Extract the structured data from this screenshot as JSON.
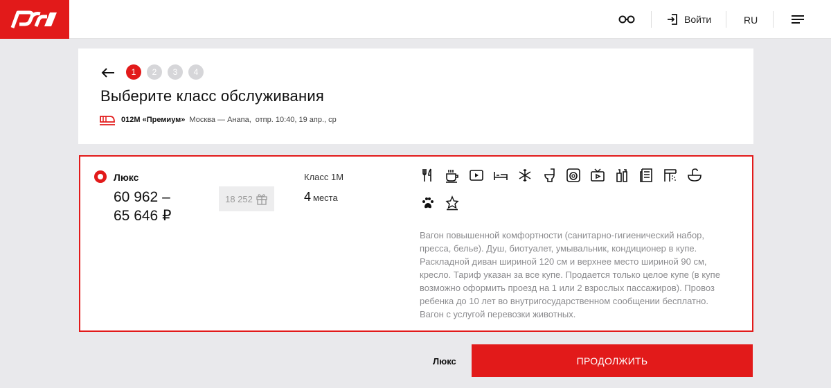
{
  "header": {
    "login_label": "Войти",
    "lang_label": "RU",
    "icons": [
      "rzd-logo",
      "glasses-icon",
      "login-icon",
      "menu-icon"
    ],
    "brand_color": "#e21a1a"
  },
  "wizard": {
    "steps": [
      "1",
      "2",
      "3",
      "4"
    ],
    "active_step": 1
  },
  "page": {
    "title": "Выберите класс обслуживания",
    "train_number": "012М «Премиум»",
    "route": "Москва — Анапа,",
    "departure": "отпр. 10:40, 19 апр., ср"
  },
  "option": {
    "name": "Люкс",
    "price_line1": "60 962 –",
    "price_line2": "65 646 ₽",
    "bonus_points": "18 252",
    "car_class": "Класс 1М",
    "seats_count": "4",
    "seats_label": "места",
    "amenities": [
      "restaurant-icon",
      "coffee-icon",
      "video-icon",
      "bed-icon",
      "air-conditioner-icon",
      "toilet-icon",
      "washing-machine-icon",
      "tv-icon",
      "hygiene-kit-icon",
      "press-icon",
      "shower-icon",
      "washbasin-icon",
      "pets-icon",
      "premium-service-icon"
    ],
    "description": "Вагон повышенной комфортности (санитарно-гигиенический набор, пресса, белье). Душ, биотуалет, умывальник, кондиционер в купе. Раскладной диван шириной 120 см и верхнее место шириной 90 см, кресло. Тариф указан за все купе. Продается только целое купе (в купе возможно оформить проезд на 1 или 2 взрослых пассажиров). Провоз ребенка до 10 лет во внутригосударственном сообщении бесплатно. Вагон с услугой перевозки животных."
  },
  "footer": {
    "selected_label": "Люкс",
    "continue_label": "ПРОДОЛЖИТЬ"
  }
}
